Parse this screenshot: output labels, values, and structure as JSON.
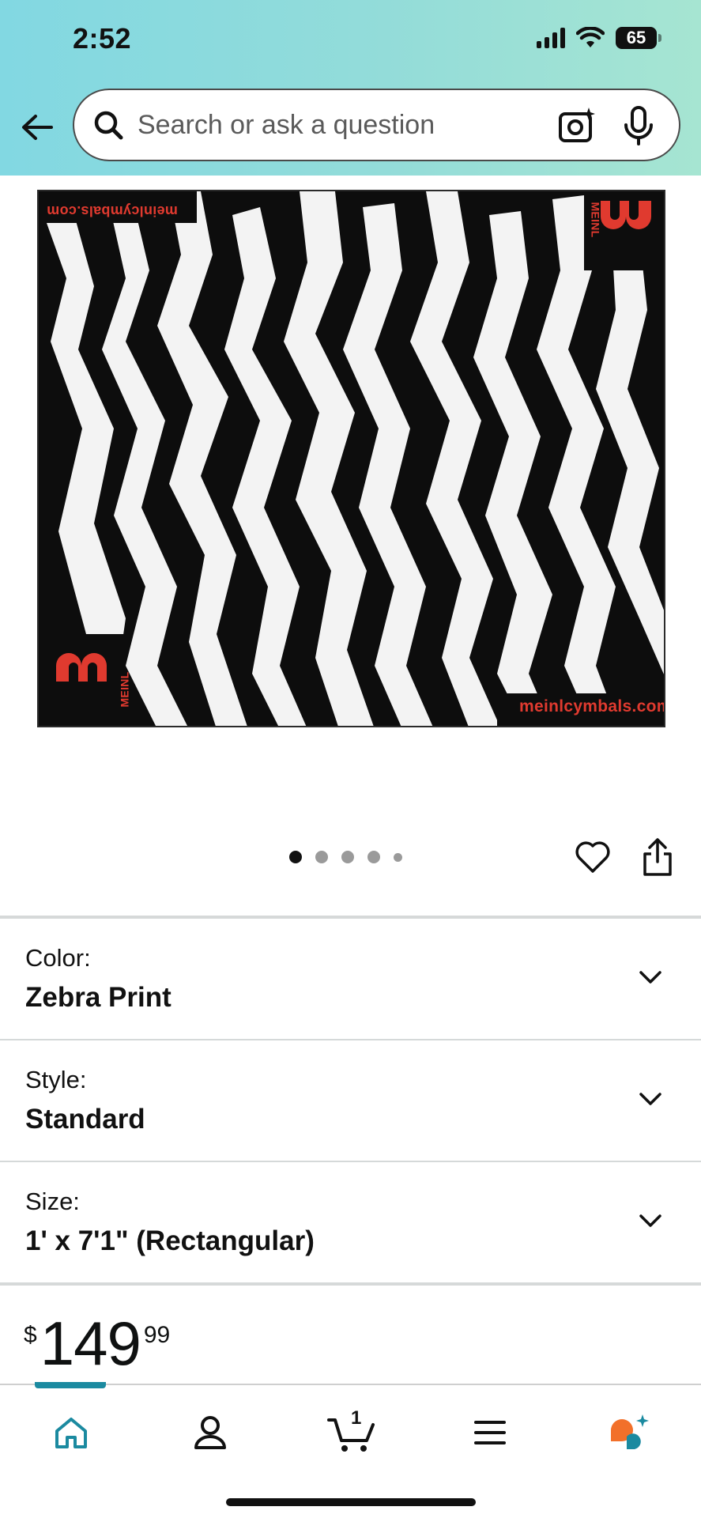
{
  "status_bar": {
    "time": "2:52",
    "battery": "65"
  },
  "header": {
    "search": {
      "placeholder": "Search or ask a question"
    }
  },
  "product_image": {
    "website_text_bottom": "meinlcymbals.com",
    "website_text_top": "meinlcymbals.com",
    "brand_text": "MEINL",
    "colors": {
      "print": "#0d0d0d",
      "stripes": "#f3f3f3",
      "accent": "#e03a2f"
    }
  },
  "carousel": {
    "total_images": 5,
    "active_index": 0
  },
  "options": [
    {
      "label": "Color:",
      "value": "Zebra Print"
    },
    {
      "label": "Style:",
      "value": "Standard"
    },
    {
      "label": "Size:",
      "value": "1' x 7'1\" (Rectangular)"
    }
  ],
  "price": {
    "symbol": "$",
    "whole": "149",
    "fraction": "99"
  },
  "bottom_nav": {
    "items": [
      {
        "name": "home",
        "active": true
      },
      {
        "name": "account",
        "active": false
      },
      {
        "name": "cart",
        "count": "1",
        "active": false
      },
      {
        "name": "menu",
        "active": false
      },
      {
        "name": "rufus-ai",
        "active": false
      }
    ],
    "accent_color": "#1b8aa0"
  }
}
